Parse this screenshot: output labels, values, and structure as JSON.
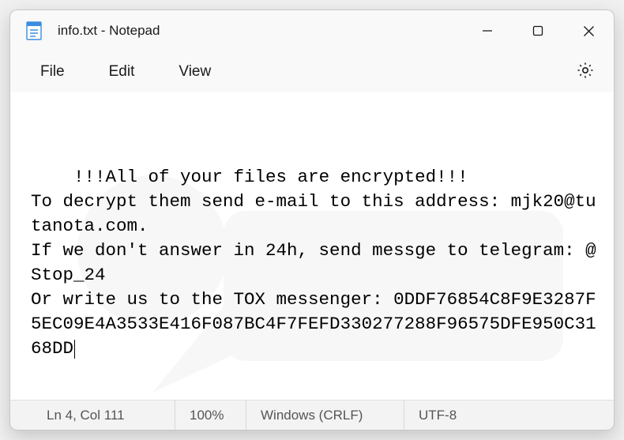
{
  "window": {
    "title": "info.txt - Notepad"
  },
  "menu": {
    "file": "File",
    "edit": "Edit",
    "view": "View"
  },
  "content": {
    "body": "!!!All of your files are encrypted!!!\nTo decrypt them send e-mail to this address: mjk20@tutanota.com.\nIf we don't answer in 24h, send messge to telegram: @Stop_24\nOr write us to the TOX messenger: 0DDF76854C8F9E3287F5EC09E4A3533E416F087BC4F7FEFD330277288F96575DFE950C3168DD"
  },
  "status": {
    "position": "Ln 4, Col 111",
    "zoom": "100%",
    "eol": "Windows (CRLF)",
    "encoding": "UTF-8"
  }
}
